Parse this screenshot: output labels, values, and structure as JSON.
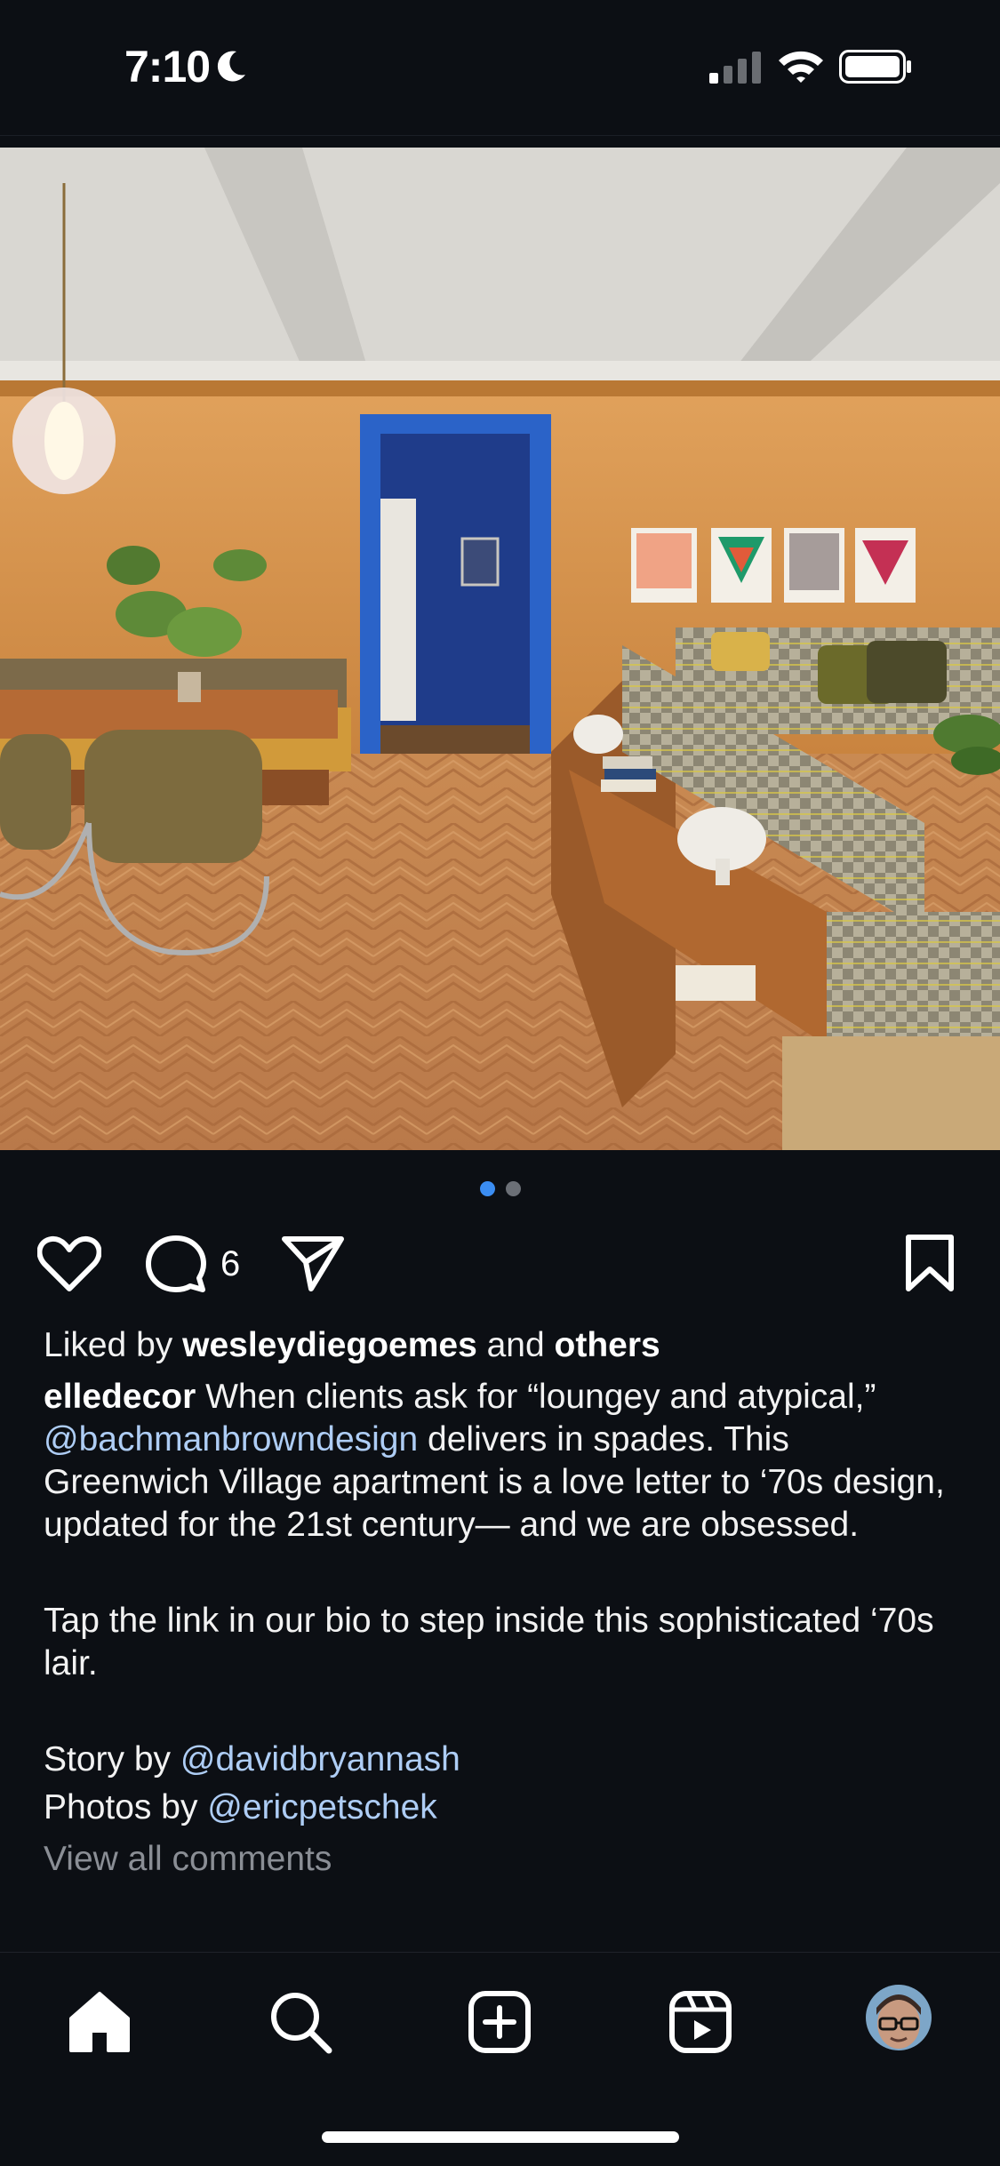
{
  "status_bar": {
    "time": "7:10"
  },
  "post": {
    "carousel": {
      "count": 2,
      "active_index": 0
    },
    "comment_count": "6",
    "liked_by": {
      "prefix": "Liked by ",
      "user": "wesleydiegoemes",
      "middle": " and ",
      "others": "others"
    },
    "caption": {
      "username": "elledecor",
      "text1": " When clients ask for “loungey and atypical,” ",
      "mention1": "@bachmanbrowndesign",
      "text2": " delivers in spades. This Greenwich Village apartment is a love letter to ‘70s design, updated for the 21st century— and we are obsessed.",
      "paragraph2": "Tap the link in our bio to step inside this sophisticated ‘70s lair.",
      "story_prefix": "Story by ",
      "story_mention": "@davidbryannash",
      "photos_prefix": "Photos by ",
      "photos_mention": "@ericpetschek"
    },
    "view_all_comments": "View all comments"
  },
  "icons": {
    "like": "heart-icon",
    "comment": "comment-bubble-icon",
    "share": "paper-plane-icon",
    "save": "bookmark-icon",
    "nav_home": "home-icon",
    "nav_search": "search-icon",
    "nav_create": "plus-square-icon",
    "nav_reels": "reels-icon",
    "nav_profile": "profile-avatar"
  },
  "colors": {
    "background": "#0c0f14",
    "mention": "#aecdf5",
    "active_dot": "#3b8df2",
    "muted_text": "#8a8e95"
  }
}
